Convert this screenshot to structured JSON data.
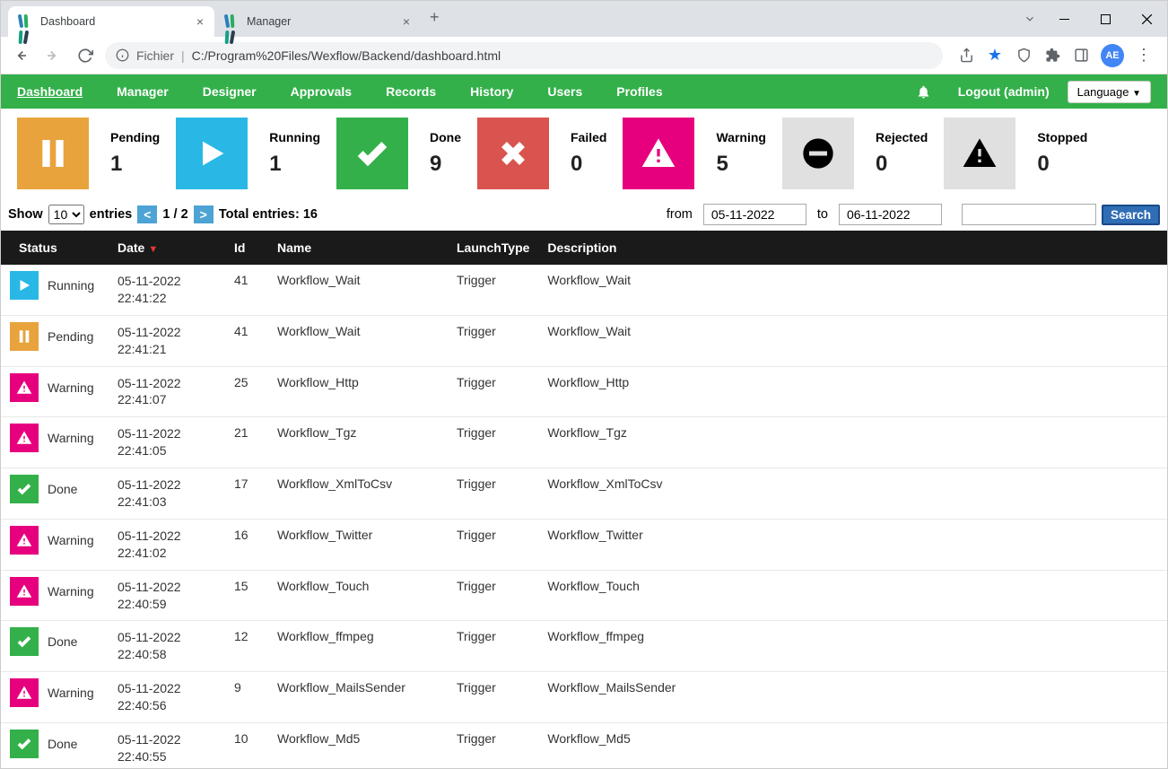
{
  "browser": {
    "tabs": [
      {
        "title": "Dashboard",
        "active": true
      },
      {
        "title": "Manager",
        "active": false
      }
    ],
    "url_prefix": "Fichier",
    "url": "C:/Program%20Files/Wexflow/Backend/dashboard.html",
    "avatar": "AE"
  },
  "navbar": {
    "items": [
      "Dashboard",
      "Manager",
      "Designer",
      "Approvals",
      "Records",
      "History",
      "Users",
      "Profiles"
    ],
    "active": "Dashboard",
    "logout": "Logout (admin)",
    "language": "Language"
  },
  "stats": [
    {
      "label": "Pending",
      "value": "1",
      "icon": "pending"
    },
    {
      "label": "Running",
      "value": "1",
      "icon": "running"
    },
    {
      "label": "Done",
      "value": "9",
      "icon": "done"
    },
    {
      "label": "Failed",
      "value": "0",
      "icon": "failed"
    },
    {
      "label": "Warning",
      "value": "5",
      "icon": "warning"
    },
    {
      "label": "Rejected",
      "value": "0",
      "icon": "rejected"
    },
    {
      "label": "Stopped",
      "value": "0",
      "icon": "stopped"
    }
  ],
  "controls": {
    "show": "Show",
    "entries_value": "10",
    "entries": "entries",
    "page": "1 / 2",
    "total": "Total entries: 16",
    "from": "from",
    "from_date": "05-11-2022",
    "to": "to",
    "to_date": "06-11-2022",
    "search": "Search"
  },
  "table": {
    "headers": [
      "Status",
      "Date",
      "Id",
      "Name",
      "LaunchType",
      "Description"
    ],
    "rows": [
      {
        "status": "Running",
        "icon": "running",
        "date": "05-11-2022",
        "time": "22:41:22",
        "id": "41",
        "name": "Workflow_Wait",
        "launch": "Trigger",
        "desc": "Workflow_Wait"
      },
      {
        "status": "Pending",
        "icon": "pending",
        "date": "05-11-2022",
        "time": "22:41:21",
        "id": "41",
        "name": "Workflow_Wait",
        "launch": "Trigger",
        "desc": "Workflow_Wait"
      },
      {
        "status": "Warning",
        "icon": "warning",
        "date": "05-11-2022",
        "time": "22:41:07",
        "id": "25",
        "name": "Workflow_Http",
        "launch": "Trigger",
        "desc": "Workflow_Http"
      },
      {
        "status": "Warning",
        "icon": "warning",
        "date": "05-11-2022",
        "time": "22:41:05",
        "id": "21",
        "name": "Workflow_Tgz",
        "launch": "Trigger",
        "desc": "Workflow_Tgz"
      },
      {
        "status": "Done",
        "icon": "done",
        "date": "05-11-2022",
        "time": "22:41:03",
        "id": "17",
        "name": "Workflow_XmlToCsv",
        "launch": "Trigger",
        "desc": "Workflow_XmlToCsv"
      },
      {
        "status": "Warning",
        "icon": "warning",
        "date": "05-11-2022",
        "time": "22:41:02",
        "id": "16",
        "name": "Workflow_Twitter",
        "launch": "Trigger",
        "desc": "Workflow_Twitter"
      },
      {
        "status": "Warning",
        "icon": "warning",
        "date": "05-11-2022",
        "time": "22:40:59",
        "id": "15",
        "name": "Workflow_Touch",
        "launch": "Trigger",
        "desc": "Workflow_Touch"
      },
      {
        "status": "Done",
        "icon": "done",
        "date": "05-11-2022",
        "time": "22:40:58",
        "id": "12",
        "name": "Workflow_ffmpeg",
        "launch": "Trigger",
        "desc": "Workflow_ffmpeg"
      },
      {
        "status": "Warning",
        "icon": "warning",
        "date": "05-11-2022",
        "time": "22:40:56",
        "id": "9",
        "name": "Workflow_MailsSender",
        "launch": "Trigger",
        "desc": "Workflow_MailsSender"
      },
      {
        "status": "Done",
        "icon": "done",
        "date": "05-11-2022",
        "time": "22:40:55",
        "id": "10",
        "name": "Workflow_Md5",
        "launch": "Trigger",
        "desc": "Workflow_Md5"
      }
    ]
  }
}
